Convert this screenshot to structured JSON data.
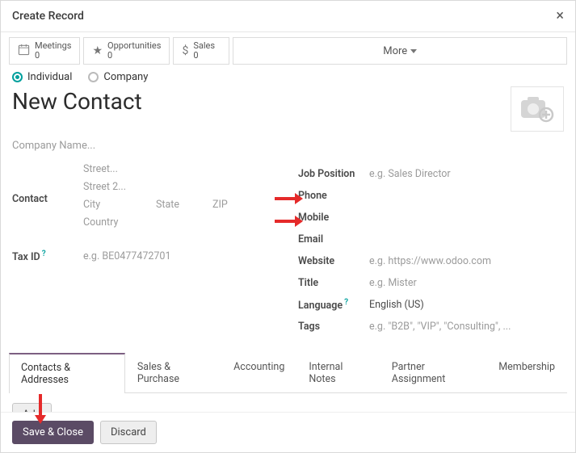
{
  "header": {
    "title": "Create Record"
  },
  "stats": {
    "meetings": {
      "label": "Meetings",
      "value": "0"
    },
    "opportunities": {
      "label": "Opportunities",
      "value": "0"
    },
    "sales": {
      "label": "Sales",
      "value": "0"
    },
    "more": "More"
  },
  "radio": {
    "individual": "Individual",
    "company": "Company"
  },
  "title": "New Contact",
  "company_placeholder": "Company Name...",
  "left": {
    "contact_label": "Contact",
    "street": "Street...",
    "street2": "Street 2...",
    "city": "City",
    "state": "State",
    "zip": "ZIP",
    "country": "Country",
    "taxid_label": "Tax ID",
    "taxid_placeholder": "e.g. BE0477472701"
  },
  "right": {
    "job_label": "Job Position",
    "job_placeholder": "e.g. Sales Director",
    "phone_label": "Phone",
    "mobile_label": "Mobile",
    "email_label": "Email",
    "website_label": "Website",
    "website_placeholder": "e.g. https://www.odoo.com",
    "title_label": "Title",
    "title_placeholder": "e.g. Mister",
    "language_label": "Language",
    "language_value": "English (US)",
    "tags_label": "Tags",
    "tags_placeholder": "e.g. \"B2B\", \"VIP\", \"Consulting\", ..."
  },
  "tabs": {
    "items": [
      "Contacts & Addresses",
      "Sales & Purchase",
      "Accounting",
      "Internal Notes",
      "Partner Assignment",
      "Membership"
    ]
  },
  "add_button": "Add",
  "footer": {
    "save": "Save & Close",
    "discard": "Discard"
  }
}
